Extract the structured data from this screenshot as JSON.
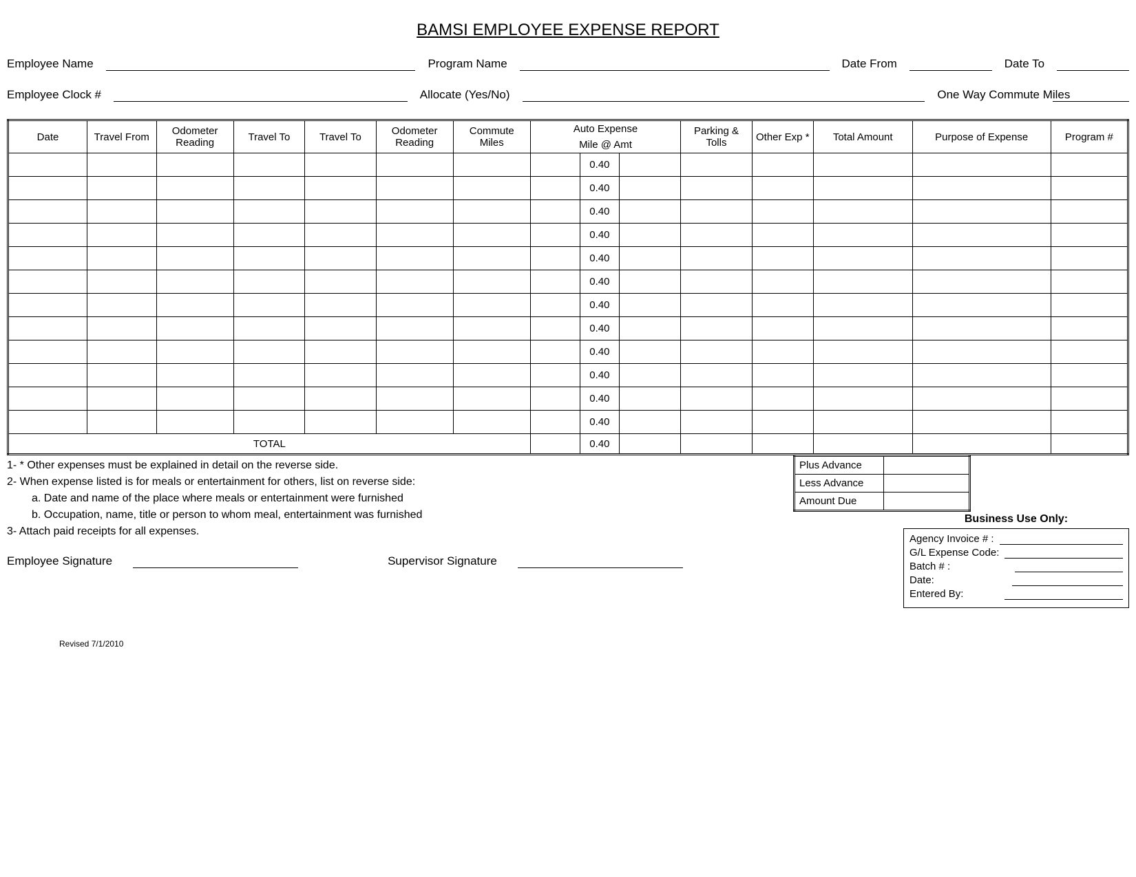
{
  "title": "BAMSI EMPLOYEE EXPENSE REPORT",
  "header": {
    "employee_name": "Employee Name",
    "program_name": "Program Name",
    "date_from": "Date From",
    "date_to": "Date To",
    "employee_clock": "Employee Clock #",
    "allocate": "Allocate (Yes/No)",
    "commute_miles": "One Way Commute Miles"
  },
  "columns": {
    "date": "Date",
    "travel_from": "Travel From",
    "odo1": "Odometer Reading",
    "travel_to1": "Travel To",
    "travel_to2": "Travel To",
    "odo2": "Odometer Reading",
    "commute": "Commute Miles",
    "auto_exp": "Auto Expense",
    "mile_at_amt": "Mile  @  Amt",
    "parking": "Parking & Tolls",
    "other": "Other Exp *",
    "total_amt": "Total Amount",
    "purpose": "Purpose of Expense",
    "program_no": "Program #"
  },
  "rate": "0.40",
  "total_label": "TOTAL",
  "notes": {
    "n1": "1- * Other expenses must be explained in detail on the reverse side.",
    "n2": "2- When expense listed is for meals or entertainment for others, list on reverse side:",
    "n2a": "a. Date and name of the place where meals or entertainment were furnished",
    "n2b": "b. Occupation, name, title or person to whom meal, entertainment was furnished",
    "n3": "3- Attach paid receipts for all expenses."
  },
  "advance": {
    "plus": "Plus Advance",
    "less": "Less Advance",
    "due": "Amount Due"
  },
  "signatures": {
    "emp": "Employee Signature",
    "sup": "Supervisor Signature"
  },
  "business": {
    "heading": "Business Use Only:",
    "agency": "Agency Invoice # :",
    "gl": "G/L Expense Code:",
    "batch": "Batch # :",
    "date": "Date:",
    "entered": "Entered By:"
  },
  "revised": "Revised 7/1/2010"
}
